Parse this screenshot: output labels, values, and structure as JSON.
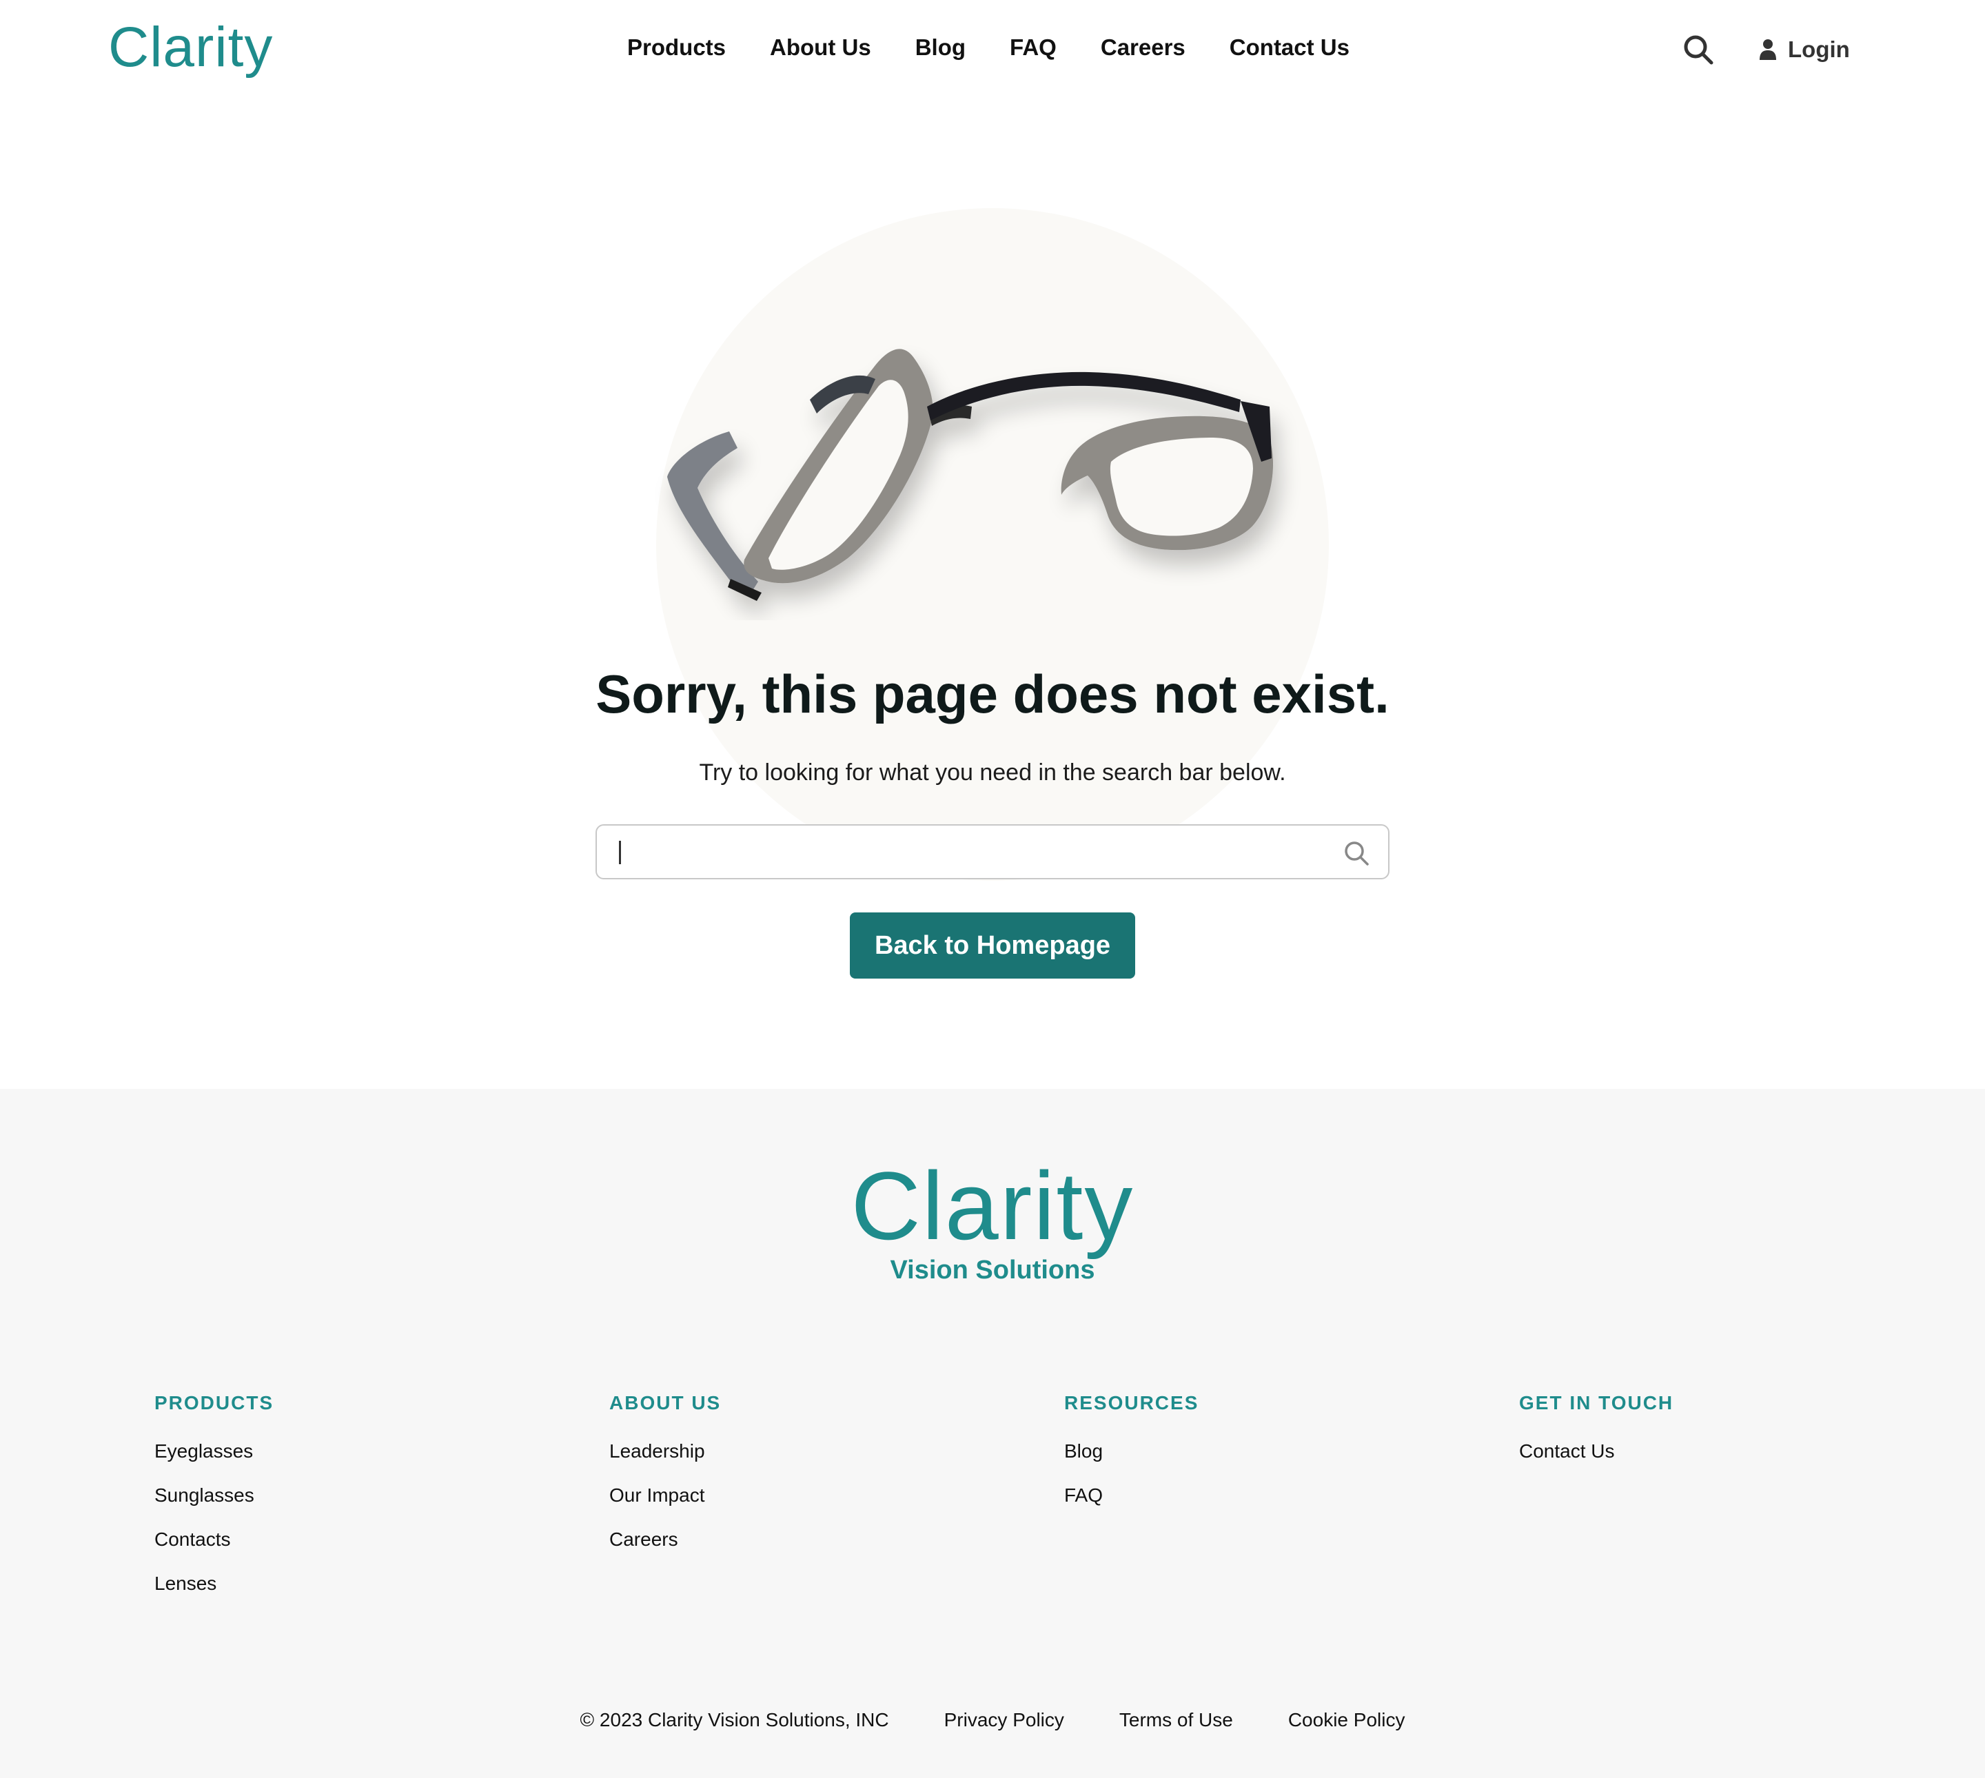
{
  "colors": {
    "brand": "#1f8c8c",
    "button": "#1a7473",
    "nav_text": "#111111",
    "hero_circle": "#faf9f6",
    "footer_bg": "#f7f7f7"
  },
  "header": {
    "logo": "Clarity",
    "nav": [
      "Products",
      "About Us",
      "Blog",
      "FAQ",
      "Careers",
      "Contact Us"
    ],
    "search_icon": "search-icon",
    "login_icon": "user-icon",
    "login_label": "Login"
  },
  "hero": {
    "image": "broken-glasses",
    "title": "Sorry, this page does not exist.",
    "subtitle": "Try to looking for what you need in the search bar below.",
    "search": {
      "value": "",
      "placeholder": "",
      "icon": "search-icon"
    },
    "cta": "Back to Homepage"
  },
  "footer": {
    "logo": "Clarity",
    "tagline": "Vision Solutions",
    "columns": [
      {
        "heading": "PRODUCTS",
        "links": [
          "Eyeglasses",
          "Sunglasses",
          "Contacts",
          "Lenses"
        ]
      },
      {
        "heading": "ABOUT US",
        "links": [
          "Leadership",
          "Our Impact",
          "Careers"
        ]
      },
      {
        "heading": "RESOURCES",
        "links": [
          "Blog",
          "FAQ"
        ]
      },
      {
        "heading": "GET IN TOUCH",
        "links": [
          "Contact Us"
        ]
      }
    ],
    "copyright": "© 2023 Clarity Vision Solutions, INC",
    "legal_links": [
      "Privacy Policy",
      "Terms of Use",
      "Cookie Policy"
    ]
  }
}
